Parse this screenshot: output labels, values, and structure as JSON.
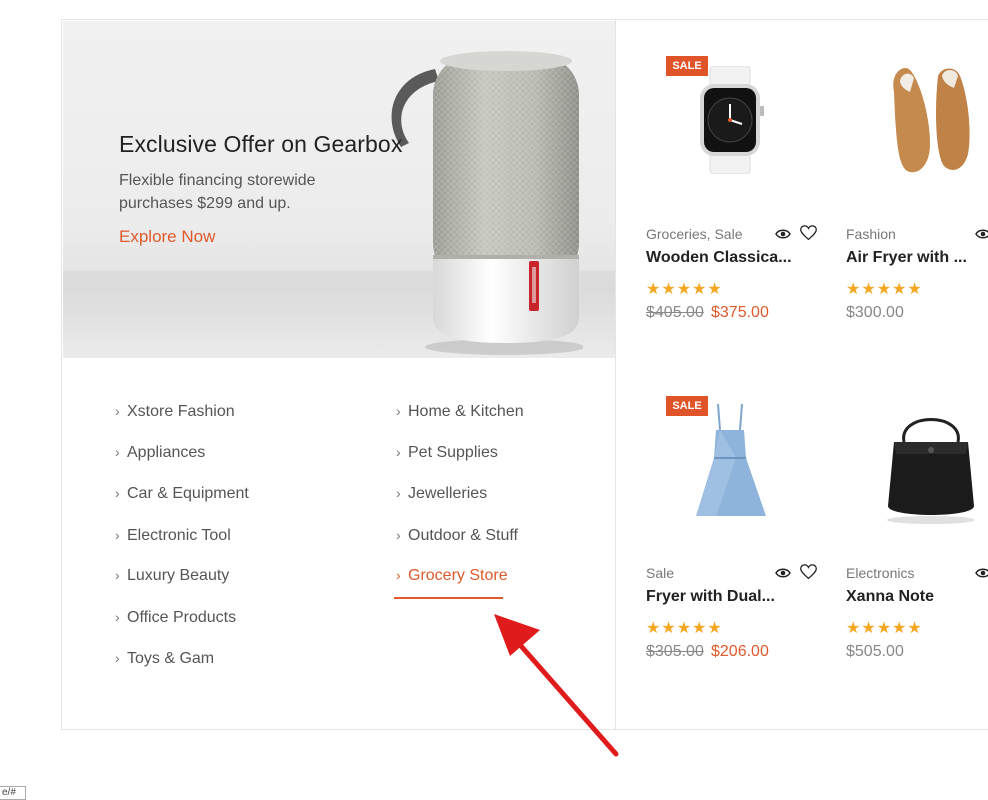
{
  "banner": {
    "title": "Exclusive Offer on Gearbox",
    "subtitle": "Flexible financing storewide purchases $299 and up.",
    "cta": "Explore Now"
  },
  "categories": {
    "left": [
      "Xstore Fashion",
      "Appliances",
      "Car & Equipment",
      "Electronic Tool",
      "Luxury Beauty",
      "Office Products",
      "Toys & Gam"
    ],
    "right": [
      "Home & Kitchen",
      "Pet Supplies",
      "Jewelleries",
      "Outdoor & Stuff",
      "Grocery Store"
    ],
    "active": "Grocery Store"
  },
  "products": [
    {
      "badge": "SALE",
      "category": "Groceries, Sale",
      "name": "Wooden Classica...",
      "stars": "★★★★★",
      "old_price": "$405.00",
      "price": "$375.00"
    },
    {
      "badge": "",
      "category": "Fashion",
      "name": "Air Fryer with ...",
      "stars": "★★★★★",
      "old_price": "",
      "price": "$300.00"
    },
    {
      "badge": "SALE",
      "category": "Sale",
      "name": "Fryer with Dual...",
      "stars": "★★★★★",
      "old_price": "$305.00",
      "price": "$206.00"
    },
    {
      "badge": "",
      "category": "Electronics",
      "name": "Xanna Note",
      "stars": "★★★★★",
      "old_price": "",
      "price": "$505.00"
    }
  ],
  "corner_text": "e/#",
  "colors": {
    "accent": "#e05a2b",
    "star": "#f5a623",
    "arrow": "#e01b1b"
  }
}
